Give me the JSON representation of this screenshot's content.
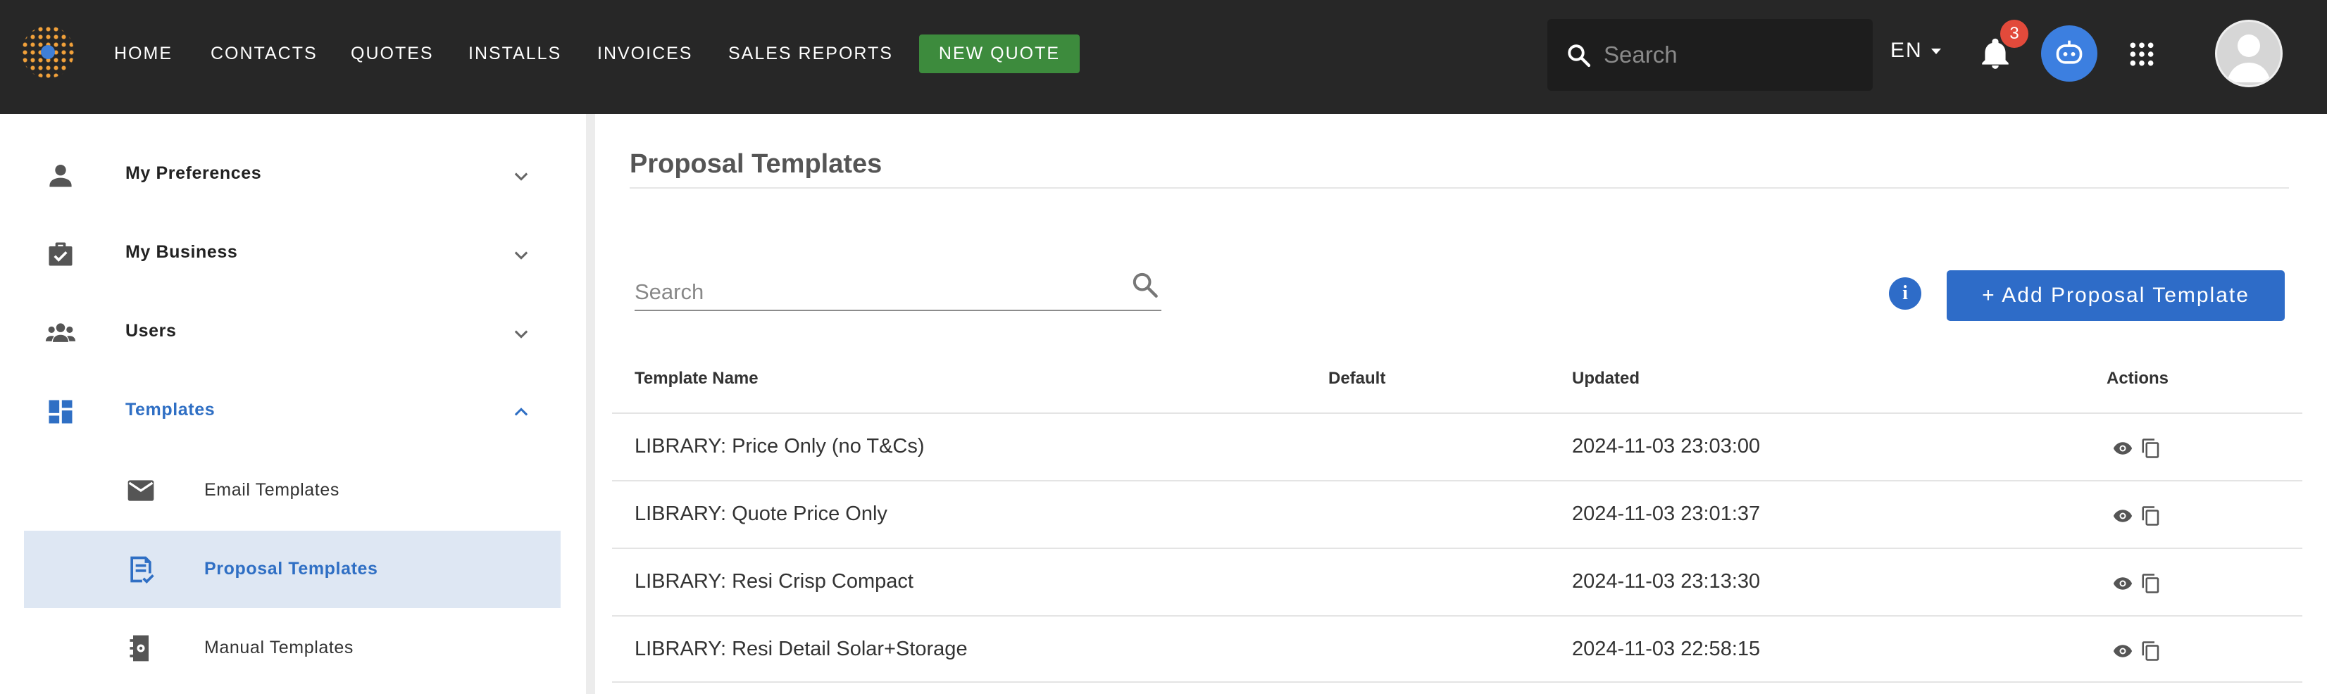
{
  "nav": {
    "items": [
      "HOME",
      "CONTACTS",
      "QUOTES",
      "INSTALLS",
      "INVOICES",
      "SALES REPORTS"
    ],
    "new_quote": "NEW QUOTE",
    "search_placeholder": "Search",
    "language": "EN",
    "notification_count": "3"
  },
  "sidebar": {
    "sections": [
      "My Preferences",
      "My Business",
      "Users",
      "Templates"
    ],
    "sub_items": [
      "Email Templates",
      "Proposal Templates",
      "Manual Templates"
    ],
    "active_item": "Proposal Templates"
  },
  "main": {
    "title": "Proposal Templates",
    "search_placeholder": "Search",
    "add_button": "+ Add Proposal Template",
    "columns": [
      "Template Name",
      "Default",
      "Updated",
      "Actions"
    ],
    "rows": [
      {
        "name": "LIBRARY: Price Only (no T&Cs)",
        "default": "",
        "updated": "2024-11-03 23:03:00"
      },
      {
        "name": "LIBRARY: Quote Price Only",
        "default": "",
        "updated": "2024-11-03 23:01:37"
      },
      {
        "name": "LIBRARY: Resi Crisp Compact",
        "default": "",
        "updated": "2024-11-03 23:13:30"
      },
      {
        "name": "LIBRARY: Resi Detail Solar+Storage",
        "default": "",
        "updated": "2024-11-03 22:58:15"
      }
    ]
  },
  "colors": {
    "topbar": "#272727",
    "accent": "#2e6cc8",
    "new_quote": "#3d8b3d",
    "active_bg": "#dee7f3",
    "badge": "#e24a3b"
  }
}
